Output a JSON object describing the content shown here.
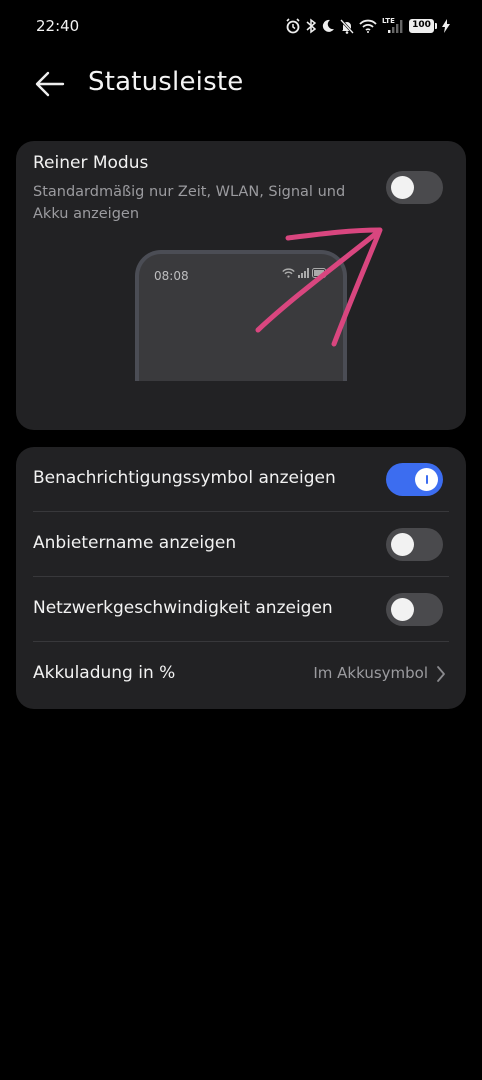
{
  "status_bar": {
    "time": "22:40",
    "icons": [
      "alarm-icon",
      "bluetooth-icon",
      "moon-icon",
      "bell-off-icon",
      "wifi-icon",
      "lte-signal-icon",
      "battery-icon",
      "charging-icon"
    ],
    "lte": "LTE",
    "battery": "100"
  },
  "header": {
    "title": "Statusleiste",
    "back_icon": "arrow-left-icon"
  },
  "pure_mode": {
    "title": "Reiner Modus",
    "subtitle": "Standardmäßig nur Zeit, WLAN, Signal und Akku anzeigen",
    "enabled": false,
    "preview_time": "08:08"
  },
  "settings": {
    "rows": [
      {
        "label": "Benachrichtigungssymbol anzeigen",
        "enabled": true
      },
      {
        "label": "Anbietername anzeigen",
        "enabled": false
      },
      {
        "label": "Netzwerkgeschwindigkeit anzeigen",
        "enabled": false
      },
      {
        "label": "Akkuladung in %",
        "value": "Im Akkusymbol"
      }
    ]
  },
  "colors": {
    "background": "#000000",
    "card": "#222224",
    "accent": "#3c6df0",
    "annotation": "#d9467f"
  }
}
